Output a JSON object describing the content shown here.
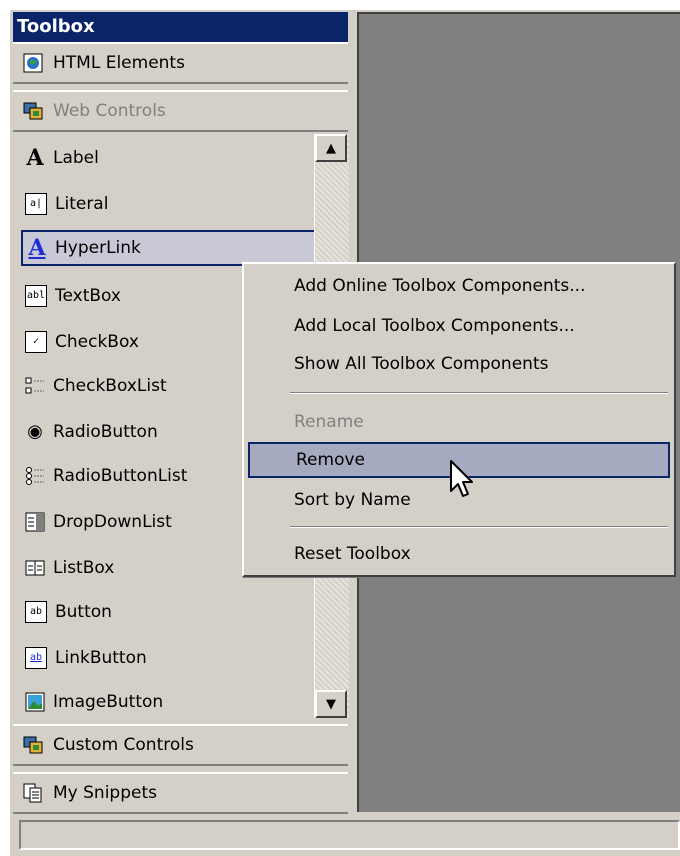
{
  "toolbox": {
    "title": "Toolbox",
    "categories": {
      "html": {
        "label": "HTML Elements",
        "icon": "html-elements-icon"
      },
      "web": {
        "label": "Web Controls",
        "icon": "web-controls-icon"
      },
      "custom": {
        "label": "Custom Controls",
        "icon": "custom-controls-icon"
      },
      "snippets": {
        "label": "My Snippets",
        "icon": "snippets-icon"
      }
    },
    "items": [
      {
        "label": "Label",
        "icon": "label-icon"
      },
      {
        "label": "Literal",
        "icon": "literal-icon"
      },
      {
        "label": "HyperLink",
        "icon": "hyperlink-icon",
        "selected": true
      },
      {
        "label": "TextBox",
        "icon": "textbox-icon"
      },
      {
        "label": "CheckBox",
        "icon": "checkbox-icon"
      },
      {
        "label": "CheckBoxList",
        "icon": "checkboxlist-icon"
      },
      {
        "label": "RadioButton",
        "icon": "radiobutton-icon"
      },
      {
        "label": "RadioButtonList",
        "icon": "radiobuttonlist-icon"
      },
      {
        "label": "DropDownList",
        "icon": "dropdownlist-icon"
      },
      {
        "label": "ListBox",
        "icon": "listbox-icon"
      },
      {
        "label": "Button",
        "icon": "button-icon"
      },
      {
        "label": "LinkButton",
        "icon": "linkbutton-icon"
      },
      {
        "label": "ImageButton",
        "icon": "imagebutton-icon"
      }
    ]
  },
  "context_menu": {
    "items": [
      {
        "label": "Add Online Toolbox Components..."
      },
      {
        "label": "Add Local Toolbox Components..."
      },
      {
        "label": "Show All Toolbox Components"
      },
      {
        "label": "Rename",
        "disabled": true
      },
      {
        "label": "Remove",
        "highlighted": true
      },
      {
        "label": "Sort by Name"
      },
      {
        "label": "Reset Toolbox"
      }
    ]
  },
  "icon_glyphs": {
    "label": "A",
    "literal": "a|",
    "textbox": "abl",
    "checkbox": "✓",
    "button": "ab",
    "linkbutton": "ab",
    "radio": "◉"
  },
  "colors": {
    "title_bar": "#0a246a",
    "panel": "#d4d0c8",
    "design_area": "#808080",
    "highlight": "#a6aac0"
  }
}
